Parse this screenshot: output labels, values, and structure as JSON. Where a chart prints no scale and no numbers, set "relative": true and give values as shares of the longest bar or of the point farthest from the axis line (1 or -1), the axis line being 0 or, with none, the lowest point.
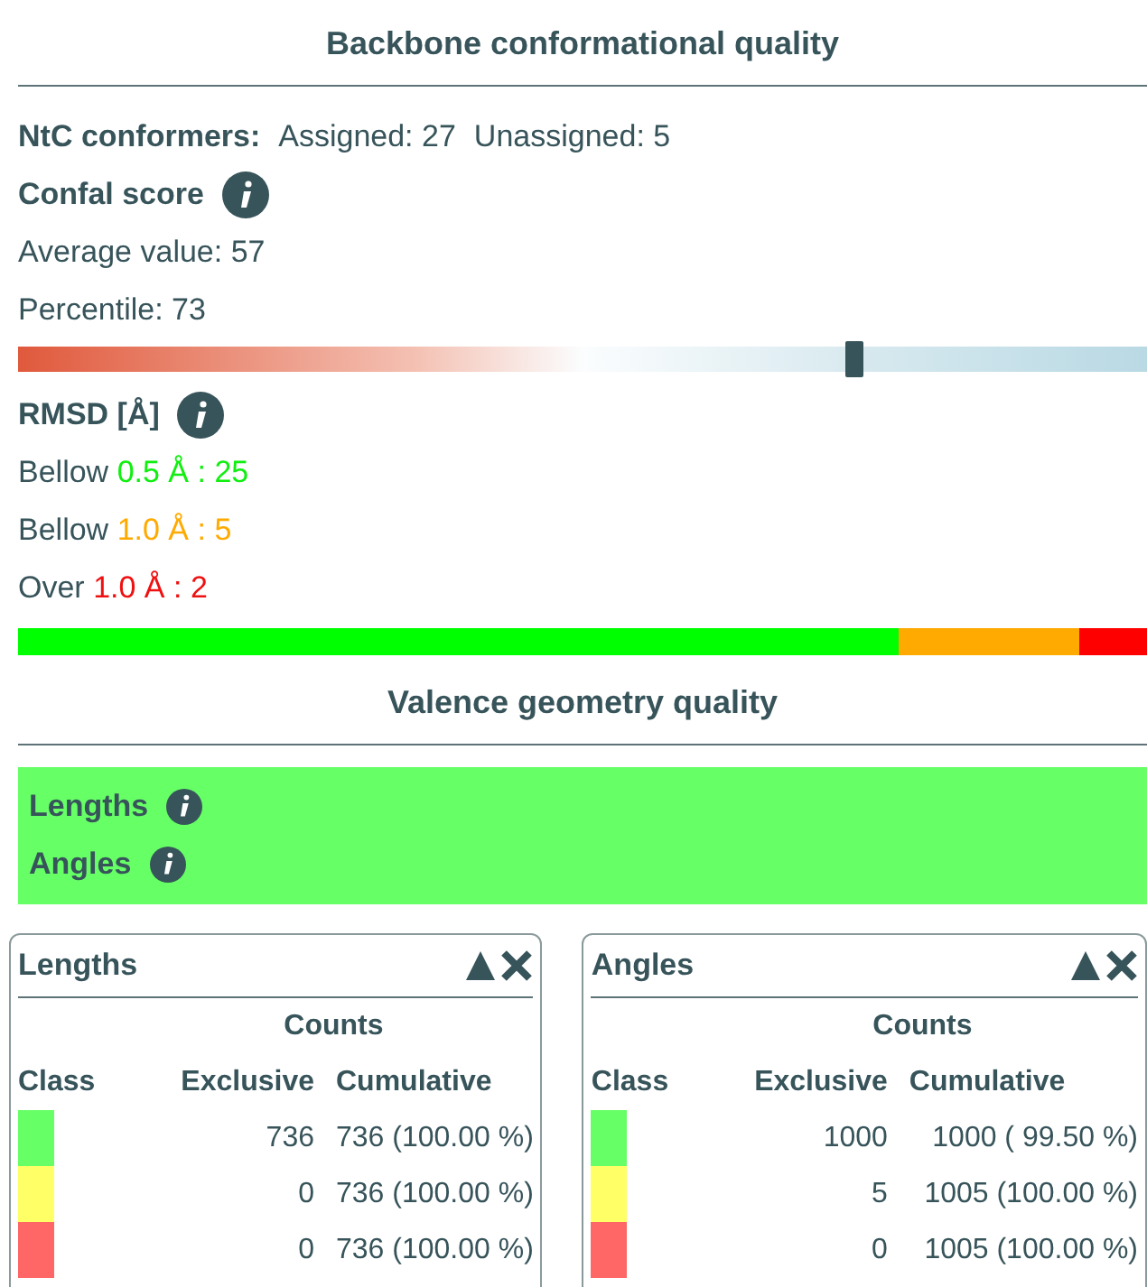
{
  "backbone": {
    "title": "Backbone conformational quality",
    "ntc": {
      "label": "NtC conformers:",
      "assigned": "Assigned: 27",
      "unassigned": "Unassigned: 5"
    },
    "confal": {
      "title": "Confal score",
      "average": "Average value: 57",
      "percentile": "Percentile: 73",
      "level": 0.74
    },
    "rmsd": {
      "title": "RMSD [Å]",
      "lines": [
        {
          "prefix": "Bellow",
          "value": "0.5 Å : 25",
          "color": "#11ee11"
        },
        {
          "prefix": "Bellow",
          "value": "1.0 Å : 5",
          "color": "#ffaa00"
        },
        {
          "prefix": "Over",
          "value": "1.0 Å : 2",
          "color": "#ee1111"
        }
      ],
      "chart_data": {
        "type": "bar",
        "orientation": "horizontal",
        "stacked": true,
        "relative": true,
        "series": [
          {
            "color": "#00ff00",
            "values": [
              0.78
            ]
          },
          {
            "color": "#ffaa00",
            "values": [
              0.16
            ]
          },
          {
            "color": "#ff0000",
            "values": [
              0.06
            ]
          }
        ]
      }
    }
  },
  "valence": {
    "title": "Valence geometry quality",
    "summary": [
      {
        "label": "Lengths"
      },
      {
        "label": "Angles"
      }
    ],
    "tables": [
      {
        "title": "Lengths",
        "group": "Counts",
        "columns": [
          "Class",
          "Exclusive",
          "Cumulative"
        ],
        "rows": [
          {
            "color": "#66ff66",
            "exclusive": "736",
            "cumulative": "736 (100.00 %)"
          },
          {
            "color": "#ffff66",
            "exclusive": "0",
            "cumulative": "736 (100.00 %)"
          },
          {
            "color": "#ff6666",
            "exclusive": "0",
            "cumulative": "736 (100.00 %)"
          }
        ]
      },
      {
        "title": "Angles",
        "group": "Counts",
        "columns": [
          "Class",
          "Exclusive",
          "Cumulative"
        ],
        "rows": [
          {
            "color": "#66ff66",
            "exclusive": "1000",
            "cumulative": "1000 ( 99.50 %)"
          },
          {
            "color": "#ffff66",
            "exclusive": "5",
            "cumulative": "1005 (100.00 %)"
          },
          {
            "color": "#ff6666",
            "exclusive": "0",
            "cumulative": "1005 (100.00 %)"
          }
        ]
      }
    ]
  }
}
